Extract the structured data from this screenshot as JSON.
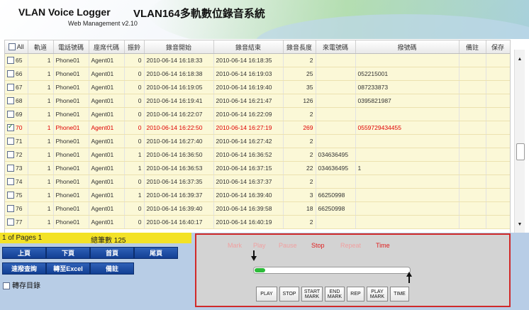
{
  "header": {
    "brand": "VLAN Voice Logger",
    "subtitle": "Web Management v2.10",
    "system_title": "VLAN164多軌數位錄音系統"
  },
  "table": {
    "columns": [
      "All",
      "軌道",
      "電話號碼",
      "座席代碼",
      "振鈴",
      "錄音開始",
      "錄音結束",
      "錄音長度",
      "來電號碼",
      "撥號碼",
      "備註",
      "保存"
    ],
    "rows": [
      {
        "id": "65",
        "track": "1",
        "phone": "Phone01",
        "agent": "Agent01",
        "ring": "0",
        "start": "2010-06-14 16:18:33",
        "end": "2010-06-14 16:18:35",
        "len": "2",
        "caller": "",
        "dialed": "",
        "selected": false
      },
      {
        "id": "66",
        "track": "1",
        "phone": "Phone01",
        "agent": "Agent01",
        "ring": "0",
        "start": "2010-06-14 16:18:38",
        "end": "2010-06-14 16:19:03",
        "len": "25",
        "caller": "",
        "dialed": "052215001",
        "selected": false
      },
      {
        "id": "67",
        "track": "1",
        "phone": "Phone01",
        "agent": "Agent01",
        "ring": "0",
        "start": "2010-06-14 16:19:05",
        "end": "2010-06-14 16:19:40",
        "len": "35",
        "caller": "",
        "dialed": "087233873",
        "selected": false
      },
      {
        "id": "68",
        "track": "1",
        "phone": "Phone01",
        "agent": "Agent01",
        "ring": "0",
        "start": "2010-06-14 16:19:41",
        "end": "2010-06-14 16:21:47",
        "len": "126",
        "caller": "",
        "dialed": "0395821987",
        "selected": false
      },
      {
        "id": "69",
        "track": "1",
        "phone": "Phone01",
        "agent": "Agent01",
        "ring": "0",
        "start": "2010-06-14 16:22:07",
        "end": "2010-06-14 16:22:09",
        "len": "2",
        "caller": "",
        "dialed": "",
        "selected": false
      },
      {
        "id": "70",
        "track": "1",
        "phone": "Phone01",
        "agent": "Agent01",
        "ring": "0",
        "start": "2010-06-14 16:22:50",
        "end": "2010-06-14 16:27:19",
        "len": "269",
        "caller": "",
        "dialed": "0559729434455",
        "selected": true
      },
      {
        "id": "71",
        "track": "1",
        "phone": "Phone01",
        "agent": "Agent01",
        "ring": "0",
        "start": "2010-06-14 16:27:40",
        "end": "2010-06-14 16:27:42",
        "len": "2",
        "caller": "",
        "dialed": "",
        "selected": false
      },
      {
        "id": "72",
        "track": "1",
        "phone": "Phone01",
        "agent": "Agent01",
        "ring": "1",
        "start": "2010-06-14 16:36:50",
        "end": "2010-06-14 16:36:52",
        "len": "2",
        "caller": "034636495",
        "dialed": "",
        "selected": false
      },
      {
        "id": "73",
        "track": "1",
        "phone": "Phone01",
        "agent": "Agent01",
        "ring": "1",
        "start": "2010-06-14 16:36:53",
        "end": "2010-06-14 16:37:15",
        "len": "22",
        "caller": "034636495",
        "dialed": "1",
        "selected": false
      },
      {
        "id": "74",
        "track": "1",
        "phone": "Phone01",
        "agent": "Agent01",
        "ring": "0",
        "start": "2010-06-14 16:37:35",
        "end": "2010-06-14 16:37:37",
        "len": "2",
        "caller": "",
        "dialed": "",
        "selected": false
      },
      {
        "id": "75",
        "track": "1",
        "phone": "Phone01",
        "agent": "Agent01",
        "ring": "1",
        "start": "2010-06-14 16:39:37",
        "end": "2010-06-14 16:39:40",
        "len": "3",
        "caller": "66250998",
        "dialed": "",
        "selected": false
      },
      {
        "id": "76",
        "track": "1",
        "phone": "Phone01",
        "agent": "Agent01",
        "ring": "0",
        "start": "2010-06-14 16:39:40",
        "end": "2010-06-14 16:39:58",
        "len": "18",
        "caller": "66250998",
        "dialed": "",
        "selected": false
      },
      {
        "id": "77",
        "track": "1",
        "phone": "Phone01",
        "agent": "Agent01",
        "ring": "0",
        "start": "2010-06-14 16:40:17",
        "end": "2010-06-14 16:40:19",
        "len": "2",
        "caller": "",
        "dialed": "",
        "selected": false
      }
    ]
  },
  "pager": {
    "pages": "1 of Pages 1",
    "total": "總筆數 125"
  },
  "buttons": {
    "prev": "上頁",
    "next": "下頁",
    "first": "首頁",
    "last": "尾頁",
    "query": "速撥查詢",
    "excel": "轉至Excel",
    "note": "備註"
  },
  "save_dir": {
    "label": "轉存目錄"
  },
  "player": {
    "labels": [
      {
        "text": "Mark",
        "color": "#f0a0a0"
      },
      {
        "text": "Play",
        "color": "#f0a0a0"
      },
      {
        "text": "Pause",
        "color": "#f0a0a0"
      },
      {
        "text": "Stop",
        "color": "#e02020"
      },
      {
        "text": "Repeat",
        "color": "#f0a0a0"
      },
      {
        "text": "Time",
        "color": "#e02020"
      }
    ],
    "progress": 0.07,
    "buttons": [
      "PLAY",
      "STOP",
      "START MARK",
      "END MARK",
      "REP",
      "PLAY MARK",
      "TIME"
    ]
  }
}
